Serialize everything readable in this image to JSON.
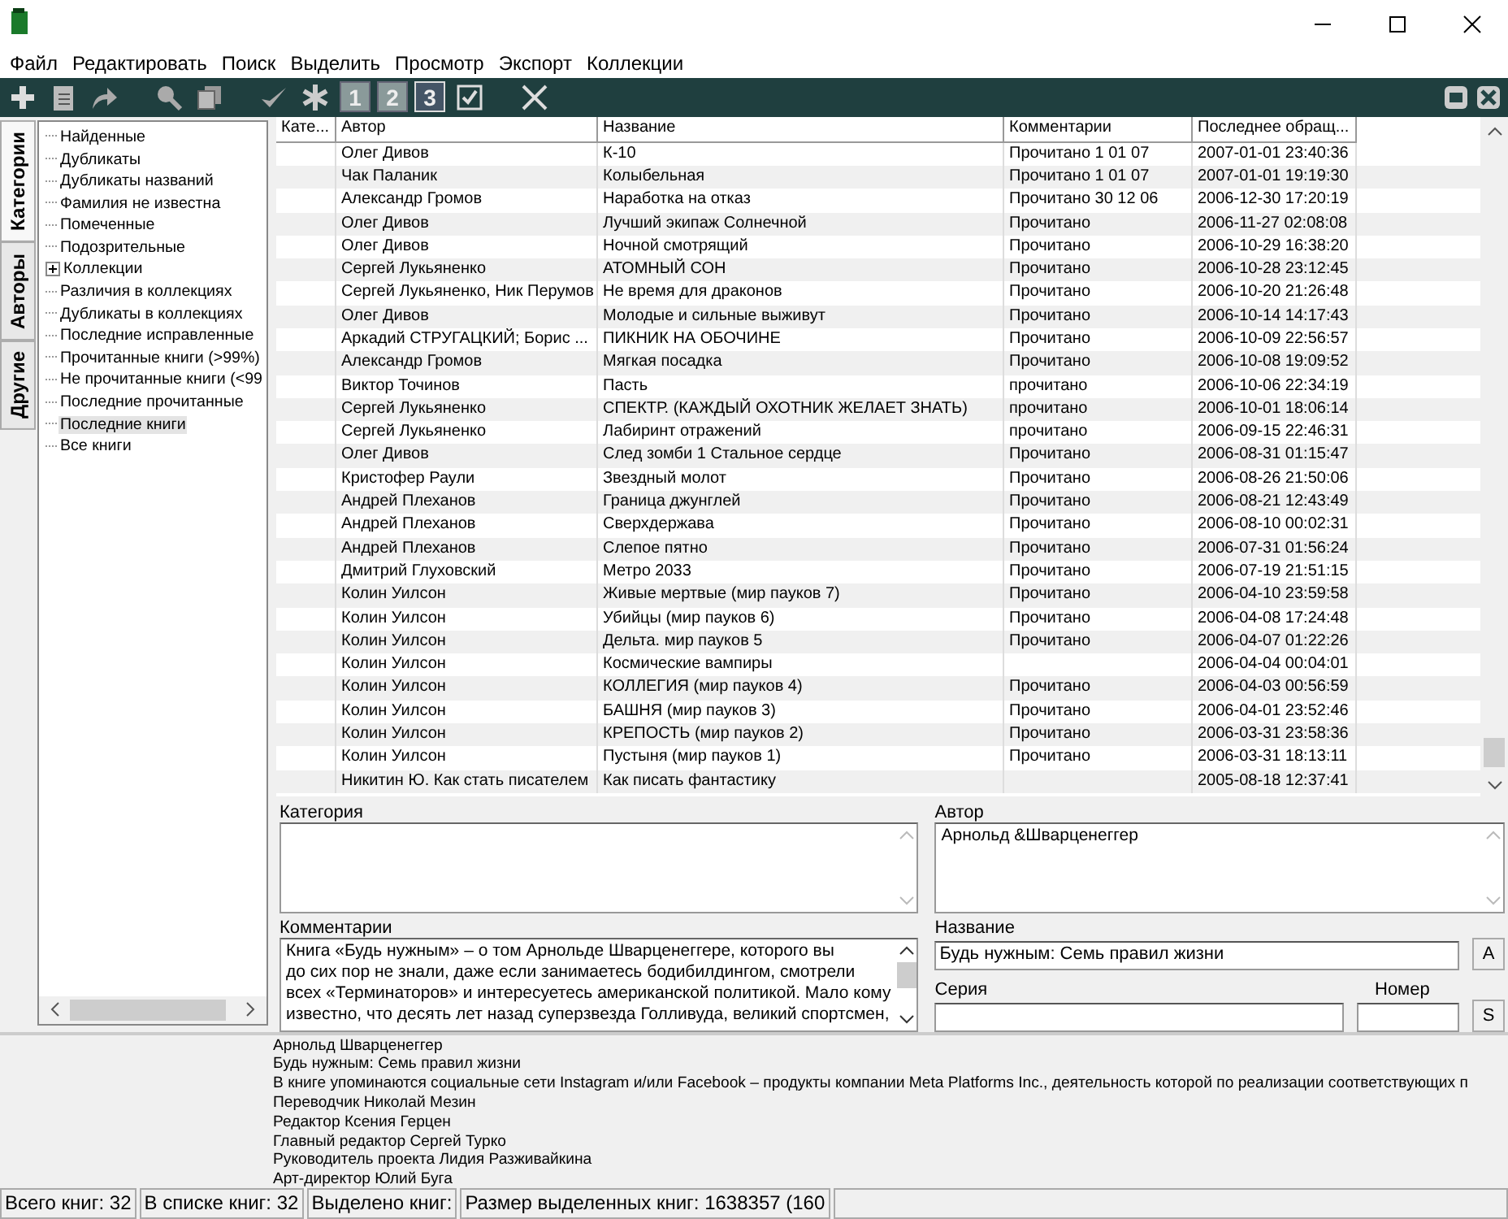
{
  "menu": [
    "Файл",
    "Редактировать",
    "Поиск",
    "Выделить",
    "Просмотр",
    "Экспорт",
    "Коллекции"
  ],
  "toolbar": [
    {
      "kind": "plus",
      "selected": false
    },
    {
      "kind": "document",
      "selected": false
    },
    {
      "kind": "arrow",
      "selected": false
    },
    {
      "kind": "gap"
    },
    {
      "kind": "search",
      "selected": false
    },
    {
      "kind": "copy",
      "selected": false
    },
    {
      "kind": "gap"
    },
    {
      "kind": "check-arrow",
      "selected": false
    },
    {
      "kind": "asterisk",
      "selected": false
    },
    {
      "kind": "number",
      "label": "1",
      "selected": false
    },
    {
      "kind": "number",
      "label": "2",
      "selected": false
    },
    {
      "kind": "number",
      "label": "3",
      "selected": true
    },
    {
      "kind": "checkbox",
      "selected": false
    },
    {
      "kind": "gap"
    },
    {
      "kind": "close",
      "selected": false
    }
  ],
  "side_tabs": [
    {
      "label": "Категории",
      "selected": true
    },
    {
      "label": "Авторы",
      "selected": false
    },
    {
      "label": "Другие",
      "selected": false
    }
  ],
  "tree": [
    {
      "label": "Найденные",
      "selected": false
    },
    {
      "label": "Дубликаты",
      "selected": false
    },
    {
      "label": "Дубликаты названий",
      "selected": false
    },
    {
      "label": "Фамилия не известна",
      "selected": false
    },
    {
      "label": "Помеченные",
      "selected": false
    },
    {
      "label": "Подозрительные",
      "selected": false
    },
    {
      "label": "Коллекции",
      "selected": false,
      "expanded": false
    },
    {
      "label": "Различия в коллекциях",
      "selected": false
    },
    {
      "label": "Дубликаты в коллекциях",
      "selected": false
    },
    {
      "label": "Последние исправленные",
      "selected": false
    },
    {
      "label": "Прочитанные книги (>99%)",
      "selected": false
    },
    {
      "label": "Не прочитанные книги (<99",
      "selected": false
    },
    {
      "label": "Последние прочитанные",
      "selected": false
    },
    {
      "label": "Последние книги",
      "selected": true
    },
    {
      "label": "Все книги",
      "selected": false
    }
  ],
  "table": {
    "columns": [
      "Кате...",
      "Автор",
      "Название",
      "Комментарии",
      "Последнее обращ..."
    ],
    "rows": [
      [
        "",
        "Олег Дивов",
        "К-10",
        "Прочитано 1 01 07",
        "2007-01-01  23:40:36"
      ],
      [
        "",
        "Чак Паланик",
        "Колыбельная",
        "Прочитано 1 01 07",
        "2007-01-01  19:19:30"
      ],
      [
        "",
        "Александр Громов",
        "Наработка на отказ",
        "Прочитано 30 12 06",
        "2006-12-30  17:20:19"
      ],
      [
        "",
        "Олег Дивов",
        "Лучший экипаж Солнечной",
        "Прочитано",
        "2006-11-27  02:08:08"
      ],
      [
        "",
        "Олег Дивов",
        "Ночной смотрящий",
        "Прочитано",
        "2006-10-29  16:38:20"
      ],
      [
        "",
        "Сергей Лукьяненко",
        "АТОМНЫЙ СОН",
        "Прочитано",
        "2006-10-28  23:12:45"
      ],
      [
        "",
        "Сергей Лукьяненко, Ник Перумов",
        "Не время для драконов",
        "Прочитано",
        "2006-10-20  21:26:48"
      ],
      [
        "",
        "Олег Дивов",
        "Молодые и сильные выживут",
        "Прочитано",
        "2006-10-14  14:17:43"
      ],
      [
        "",
        "Аркадий СТРУГАЦКИЙ; Борис ...",
        "ПИКНИК НА ОБОЧИНЕ",
        "Прочитано",
        "2006-10-09  22:56:57"
      ],
      [
        "",
        "Александр Громов",
        "Мягкая посадка",
        "Прочитано",
        "2006-10-08  19:09:52"
      ],
      [
        "",
        "Виктор Точинов",
        "Пасть",
        "прочитано",
        "2006-10-06  22:34:19"
      ],
      [
        "",
        "Сергей Лукьяненко",
        "СПЕКТР. (КАЖДЫЙ ОХОТНИК ЖЕЛАЕТ ЗНАТЬ)",
        "прочитано",
        "2006-10-01  18:06:14"
      ],
      [
        "",
        "Сергей Лукьяненко",
        "Лабиринт отражений",
        "прочитано",
        "2006-09-15  22:46:31"
      ],
      [
        "",
        "Олег Дивов",
        "След зомби 1 Стальное сердце",
        "Прочитано",
        "2006-08-31  01:15:47"
      ],
      [
        "",
        "Кристофер Раули",
        "Звездный молот",
        "Прочитано",
        "2006-08-26  21:50:06"
      ],
      [
        "",
        "Андрей Плеханов",
        "Граница джунглей",
        "Прочитано",
        "2006-08-21  12:43:49"
      ],
      [
        "",
        "Андрей Плеханов",
        "Сверхдержава",
        "Прочитано",
        "2006-08-10  00:02:31"
      ],
      [
        "",
        "Андрей Плеханов",
        "Слепое пятно",
        "Прочитано",
        "2006-07-31  01:56:24"
      ],
      [
        "",
        "Дмитрий Глуховский",
        "Метро 2033",
        "Прочитано",
        "2006-07-19  21:51:15"
      ],
      [
        "",
        "Колин Уилсон",
        "Живые мертвые  (мир пауков 7)",
        "Прочитано",
        "2006-04-10  23:59:58"
      ],
      [
        "",
        "Колин Уилсон",
        "Убийцы (мир пауков 6)",
        "Прочитано",
        "2006-04-08  17:24:48"
      ],
      [
        "",
        "Колин Уилсон",
        "Дельта. мир пауков 5",
        "Прочитано",
        "2006-04-07  01:22:26"
      ],
      [
        "",
        "Колин Уилсон",
        "Космические вампиры",
        "",
        "2006-04-04  00:04:01"
      ],
      [
        "",
        "Колин Уилсон",
        "КОЛЛЕГИЯ  (мир пауков 4)",
        "Прочитано",
        "2006-04-03  00:56:59"
      ],
      [
        "",
        "Колин Уилсон",
        "БАШНЯ  (мир пауков 3)",
        "Прочитано",
        "2006-04-01  23:52:46"
      ],
      [
        "",
        "Колин Уилсон",
        "КРЕПОСТЬ (мир пауков 2)",
        "Прочитано",
        "2006-03-31  23:58:36"
      ],
      [
        "",
        "Колин Уилсон",
        "Пустыня (мир пауков 1)",
        "Прочитано",
        "2006-03-31  18:13:11"
      ],
      [
        "",
        "Никитин Ю. Как стать писателем",
        "Как писать фантастику",
        "",
        "2005-08-18  12:37:41"
      ]
    ]
  },
  "details": {
    "category_label": "Категория",
    "author_label": "Автор",
    "author_value": "Арнольд &Шварценеггер",
    "comments_label": "Комментарии",
    "comment_lines": [
      "Книга «Будь нужным» – о том Арнольде Шварценеггере, которого вы",
      "до сих пор не знали, даже если занимаетесь бодибилдингом, смотрели",
      "всех «Терминаторов» и интересуетесь американской политикой. Мало кому",
      "известно, что десять лет назад суперзвезда Голливуда, великий спортсмен,"
    ],
    "title_label": "Название",
    "title_value": "Будь нужным: Семь правил жизни",
    "title_button": "A",
    "series_label": "Серия",
    "number_label": "Номер",
    "series_button": "S"
  },
  "info_lines": [
    "Арнольд Шварценеггер",
    "Будь нужным: Семь правил жизни",
    "В книге упоминаются социальные сети Instagram и/или Facebook – продукты компании Meta Platforms Inc., деятельность которой по реализации соответствующих п",
    "Переводчик Николай Мезин",
    "Редактор Ксения Герцен",
    "Главный редактор Сергей Турко",
    "Руководитель проекта Лидия Разживайкина",
    "Арт-директор Юлий Буга"
  ],
  "status_bar": [
    "Всего книг: 32",
    "В списке книг: 32",
    "Выделено книг:",
    "Размер выделенных книг: 1638357  (160"
  ]
}
